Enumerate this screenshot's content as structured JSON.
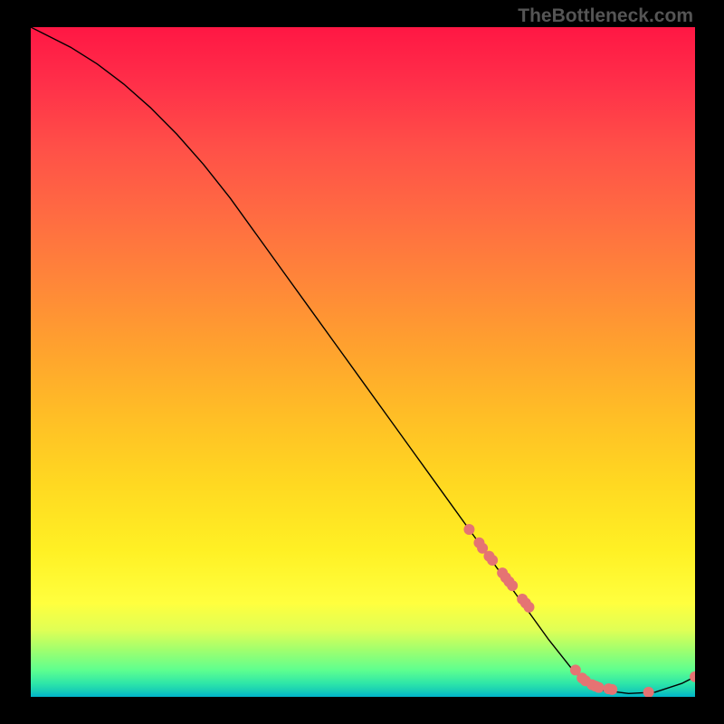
{
  "watermark": "TheBottleneck.com",
  "chart_data": {
    "type": "line",
    "title": "",
    "xlabel": "",
    "ylabel": "",
    "xlim": [
      0,
      100
    ],
    "ylim": [
      0,
      100
    ],
    "grid": false,
    "line_color": "#000000",
    "scatter_color": "#e57373",
    "scatter_radius": 6,
    "line": {
      "x": [
        0,
        6,
        10,
        14,
        18,
        22,
        26,
        30,
        34,
        38,
        42,
        46,
        50,
        54,
        58,
        62,
        66,
        70,
        74,
        78,
        82,
        86,
        90,
        94,
        98,
        100
      ],
      "y": [
        100,
        97,
        94.5,
        91.5,
        88,
        84,
        79.5,
        74.5,
        69,
        63.5,
        58,
        52.5,
        47,
        41.5,
        36,
        30.5,
        25,
        19.5,
        14,
        8.5,
        3.5,
        1.0,
        0.5,
        0.7,
        2.0,
        3.0
      ]
    },
    "scatter": {
      "x": [
        66,
        67.5,
        68,
        69,
        69.5,
        71,
        71.5,
        72,
        72.5,
        74,
        74.5,
        75,
        82,
        83,
        83.5,
        84.5,
        85,
        85.5,
        87,
        87.5,
        93,
        100
      ],
      "y": [
        25,
        23,
        22.2,
        21,
        20.4,
        18.5,
        17.8,
        17.2,
        16.6,
        14.6,
        14,
        13.4,
        4,
        2.8,
        2.4,
        1.8,
        1.6,
        1.4,
        1.2,
        1.1,
        0.7,
        3.0
      ]
    }
  }
}
